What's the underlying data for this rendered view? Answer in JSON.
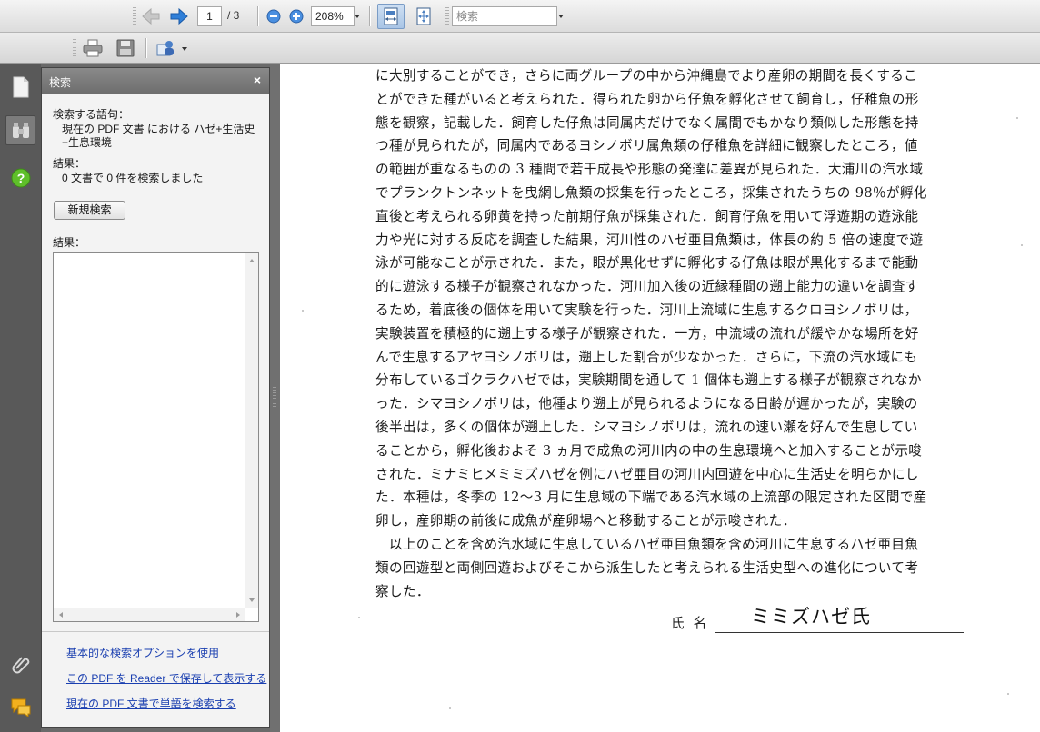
{
  "toolbar": {
    "page_current": "1",
    "page_total": "/ 3",
    "zoom": "208%",
    "search_placeholder": "検索"
  },
  "search_panel": {
    "title": "検索",
    "close_glyph": "×",
    "query_label": "検索する語句：",
    "query_line1": "現在の PDF 文書 における ハゼ+生活史",
    "query_line2": "+生息環境",
    "result_label": "結果：",
    "result_text": "0 文書で 0 件を検索しました",
    "new_search_label": "新規検索",
    "results_label": "結果：",
    "links": [
      "基本的な検索オプションを使用",
      "この PDF を Reader で保存して表示する",
      "現在の PDF 文書で単語を検索する"
    ]
  },
  "document": {
    "lines": [
      "に大別することができ，さらに両グループの中から沖縄島でより産卵の期間を長くするこ",
      "とができた種がいると考えられた．得られた卵から仔魚を孵化させて飼育し，仔稚魚の形",
      "態を観察，記載した．飼育した仔魚は同属内だけでなく属間でもかなり類似した形態を持",
      "つ種が見られたが，同属内であるヨシノボリ属魚類の仔稚魚を詳細に観察したところ，値",
      "の範囲が重なるものの 3 種間で若干成長や形態の発達に差異が見られた．大浦川の汽水域",
      "でプランクトンネットを曳網し魚類の採集を行ったところ，採集されたうちの 98％が孵化",
      "直後と考えられる卵黄を持った前期仔魚が採集された．飼育仔魚を用いて浮遊期の遊泳能",
      "力や光に対する反応を調査した結果，河川性のハゼ亜目魚類は，体長の約 5 倍の速度で遊",
      "泳が可能なことが示された．また，眼が黒化せずに孵化する仔魚は眼が黒化するまで能動",
      "的に遊泳する様子が観察されなかった．河川加入後の近縁種間の遡上能力の違いを調査す",
      "るため，着底後の個体を用いて実験を行った．河川上流域に生息するクロヨシノボリは，",
      "実験装置を積極的に遡上する様子が観察された．一方，中流域の流れが緩やかな場所を好",
      "んで生息するアヤヨシノボリは，遡上した割合が少なかった．さらに，下流の汽水域にも",
      "分布しているゴクラクハゼでは，実験期間を通して 1 個体も遡上する様子が観察されなか",
      "った．シマヨシノボリは，他種より遡上が見られるようになる日齢が遅かったが，実験の",
      "後半出は，多くの個体が遡上した．シマヨシノボリは，流れの速い瀬を好んで生息してい",
      "ることから，孵化後およそ 3 ヵ月で成魚の河川内の中の生息環境へと加入することが示唆",
      "された．ミナミヒメミミズハゼを例にハゼ亜目の河川内回遊を中心に生活史を明らかにし",
      "た．本種は，冬季の 12〜3 月に生息域の下端である汽水域の上流部の限定された区間で産",
      "卵し，産卵期の前後に成魚が産卵場へと移動することが示唆された．",
      "　以上のことを含め汽水域に生息しているハゼ亜目魚類を含め河川に生息するハゼ亜目魚",
      "類の回遊型と両側回遊およびそこから派生したと考えられる生活史型への進化について考",
      "察した．"
    ],
    "signature_label": "氏名",
    "signature_name": "ミミズハゼ氏"
  }
}
